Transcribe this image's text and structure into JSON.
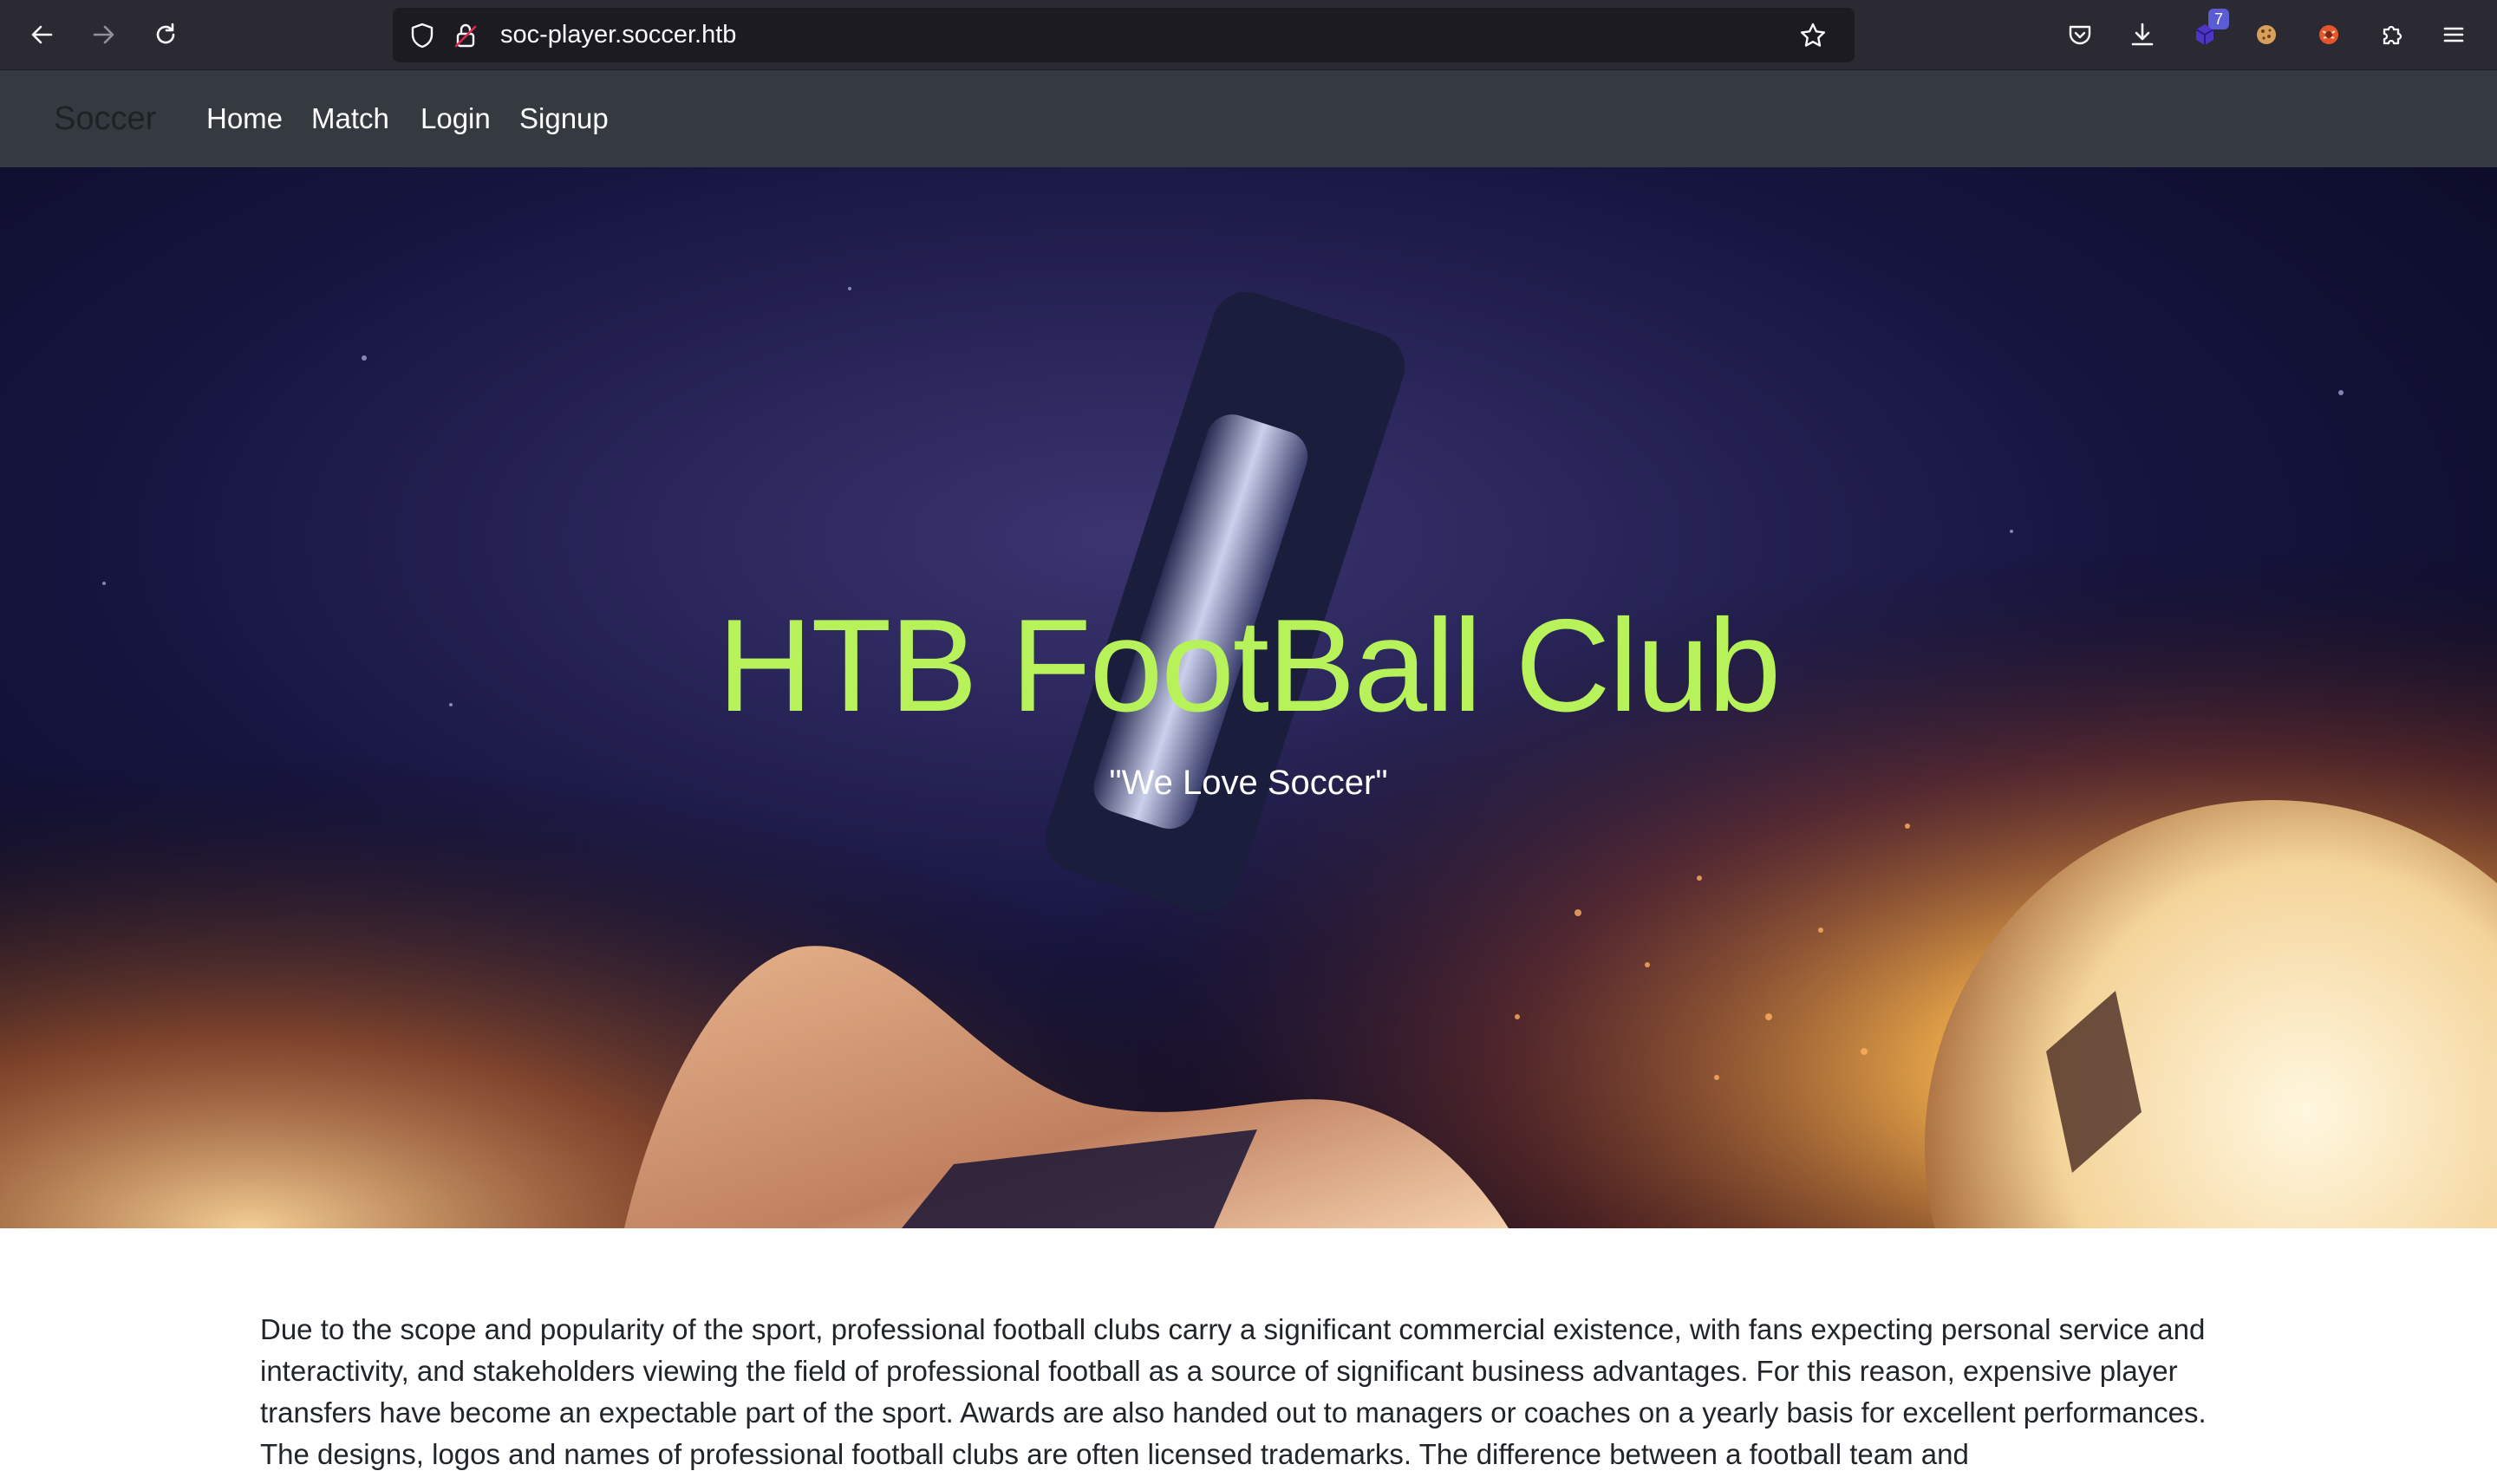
{
  "browser": {
    "url": "soc-player.soccer.htb",
    "extension_badge": "7",
    "icons": [
      "back-arrow-icon",
      "forward-arrow-icon",
      "reload-icon",
      "shield-icon",
      "lock-icon",
      "star-icon",
      "pocket-icon",
      "download-icon",
      "extension-icon",
      "cookie-icon",
      "extension-icon",
      "puzzle-icon",
      "hamburger-menu-icon"
    ]
  },
  "nav": {
    "brand": "Soccer",
    "links": [
      {
        "label": "Home"
      },
      {
        "label": "Match"
      },
      {
        "label": "Login"
      },
      {
        "label": "Signup"
      }
    ]
  },
  "hero": {
    "title": "HTB FootBall Club",
    "subtitle": "\"We Love Soccer\""
  },
  "content": {
    "paragraph": "Due to the scope and popularity of the sport, professional football clubs carry a significant commercial existence, with fans expecting personal service and interactivity, and stakeholders viewing the field of professional football as a source of significant business advantages. For this reason, expensive player transfers have become an expectable part of the sport. Awards are also handed out to managers or coaches on a yearly basis for excellent performances. The designs, logos and names of professional football clubs are often licensed trademarks. The difference between a football team and"
  },
  "colors": {
    "chrome_bg": "#2b2a33",
    "urlbar_bg": "#1c1b22",
    "navbar_bg": "#343a40",
    "hero_title": "#b7f25a",
    "text": "#212529"
  }
}
